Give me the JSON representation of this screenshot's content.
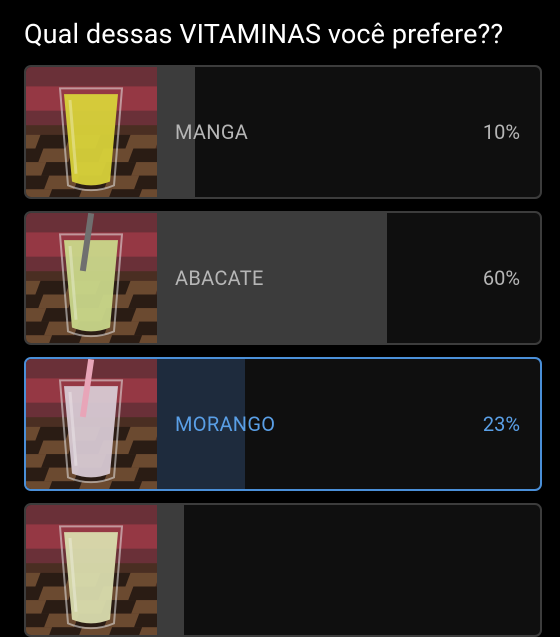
{
  "poll": {
    "question": "Qual dessas VITAMINAS você prefere??",
    "options": [
      {
        "label": "MANGA",
        "percent": "10%",
        "fraction": 0.1,
        "selected": false,
        "drink_color": "#d8d23a"
      },
      {
        "label": "ABACATE",
        "percent": "60%",
        "fraction": 0.6,
        "selected": false,
        "drink_color": "#c9d78a"
      },
      {
        "label": "MORANGO",
        "percent": "23%",
        "fraction": 0.23,
        "selected": true,
        "drink_color": "#d7c9d3"
      },
      {
        "label": "",
        "percent": "",
        "fraction": 0.07,
        "selected": false,
        "drink_color": "#d9dcae"
      }
    ]
  },
  "colors": {
    "accent": "#4a8fd8",
    "bar_fill": "#3c3c3c",
    "selected_fill": "#1e2b3d"
  }
}
